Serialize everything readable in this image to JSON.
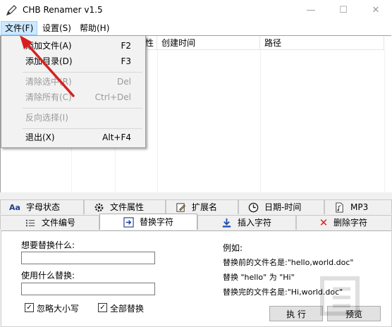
{
  "window": {
    "title": "CHB Renamer v1.5"
  },
  "menubar": {
    "file": "文件(F)",
    "settings": "设置(S)",
    "help": "帮助(H)"
  },
  "file_menu": {
    "items": [
      {
        "label": "添加文件(A)",
        "shortcut": "F2",
        "enabled": true
      },
      {
        "label": "添加目录(D)",
        "shortcut": "F3",
        "enabled": true
      },
      {
        "label": "清除选中(R)",
        "shortcut": "Del",
        "enabled": false
      },
      {
        "label": "清除所有(C)",
        "shortcut": "Ctrl+Del",
        "enabled": false
      },
      {
        "label": "反向选择(I)",
        "shortcut": "",
        "enabled": false
      },
      {
        "label": "退出(X)",
        "shortcut": "Alt+F4",
        "enabled": true
      }
    ]
  },
  "file_list": {
    "columns": {
      "attr_partial": "性",
      "created": "创建时间",
      "path": "路径"
    }
  },
  "tabs": {
    "row1": [
      {
        "label": "字母状态",
        "icon": "Aa"
      },
      {
        "label": "文件属性",
        "icon": "gear-icon"
      },
      {
        "label": "扩展名",
        "icon": "edit-icon"
      },
      {
        "label": "日期-时间",
        "icon": "clock-icon"
      },
      {
        "label": "MP3",
        "icon": "music-file-icon"
      }
    ],
    "row2": [
      {
        "label": "文件编号",
        "icon": "list-icon"
      },
      {
        "label": "替换字符",
        "icon": "replace-icon",
        "selected": true
      },
      {
        "label": "插入字符",
        "icon": "download-icon"
      },
      {
        "label": "删除字符",
        "icon": "x-icon",
        "color": "#e02020"
      }
    ]
  },
  "replace_panel": {
    "find_label": "想要替换什么:",
    "find_value": "",
    "replace_label": "使用什么替换:",
    "replace_value": "",
    "ignore_case_label": "忽略大小写",
    "ignore_case_checked": true,
    "replace_all_label": "全部替换",
    "replace_all_checked": true,
    "example_title": "例如:",
    "example_line1": "替换前的文件名是:\"hello,world.doc\"",
    "example_line2": "替换 \"hello\" 为 \"Hi\"",
    "example_line3": "替换完的文件名是:\"Hi,world.doc\""
  },
  "buttons": {
    "execute": "执 行",
    "preview": "预览"
  },
  "colors": {
    "annotation_arrow": "#d62020",
    "menu_highlight": "#cce8ff"
  }
}
